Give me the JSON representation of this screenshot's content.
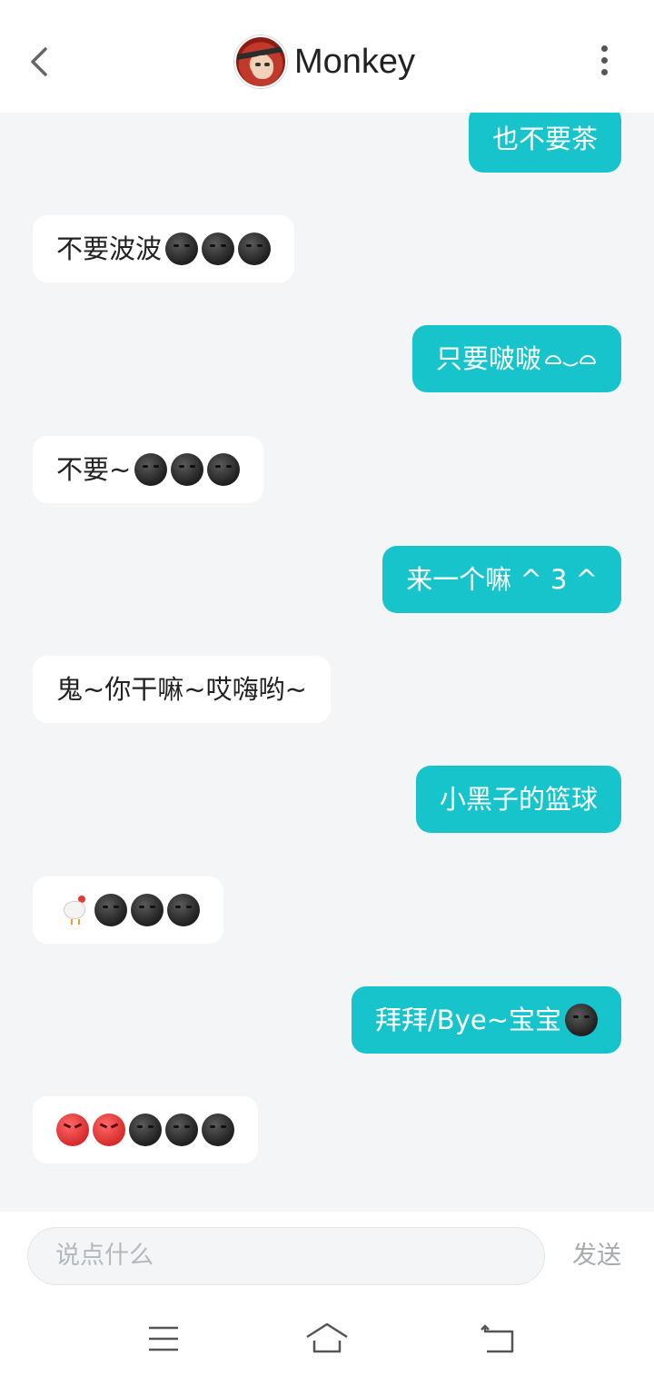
{
  "header": {
    "title": "Monkey",
    "back_icon": "chevron-left-icon",
    "more_icon": "vertical-dots-icon"
  },
  "messages": [
    {
      "side": "out",
      "text": "也不要茶",
      "emoji": []
    },
    {
      "side": "in",
      "text": "不要波波",
      "emoji": [
        "dark-moon-face",
        "dark-moon-face",
        "dark-moon-face"
      ]
    },
    {
      "side": "out",
      "text": "只要啵啵",
      "kaomoji": "◠‿◠"
    },
    {
      "side": "in",
      "text": "不要~",
      "emoji": [
        "dark-moon-face",
        "dark-moon-face",
        "dark-moon-face"
      ]
    },
    {
      "side": "out",
      "text": "来一个嘛 ^ 3 ^",
      "emoji": []
    },
    {
      "side": "in",
      "text": "鬼~你干嘛~哎嗨哟~",
      "emoji": []
    },
    {
      "side": "out",
      "text": "小黑子的篮球",
      "emoji": []
    },
    {
      "side": "in",
      "text": "",
      "emoji": [
        "chicken",
        "dark-moon-face",
        "dark-moon-face",
        "dark-moon-face"
      ]
    },
    {
      "side": "out",
      "text": "拜拜/Bye~宝宝",
      "emoji": [
        "dark-moon-face"
      ]
    },
    {
      "side": "in",
      "text": "",
      "emoji": [
        "angry-face",
        "angry-face",
        "dark-moon-face",
        "dark-moon-face",
        "dark-moon-face"
      ]
    }
  ],
  "composer": {
    "placeholder": "说点什么",
    "send_label": "发送"
  },
  "nav": {
    "menu_icon": "menu-icon",
    "home_icon": "home-icon",
    "back_icon": "back-icon"
  },
  "colors": {
    "outgoing": "#17c4cc",
    "incoming": "#ffffff",
    "background": "#f3f5f7"
  }
}
